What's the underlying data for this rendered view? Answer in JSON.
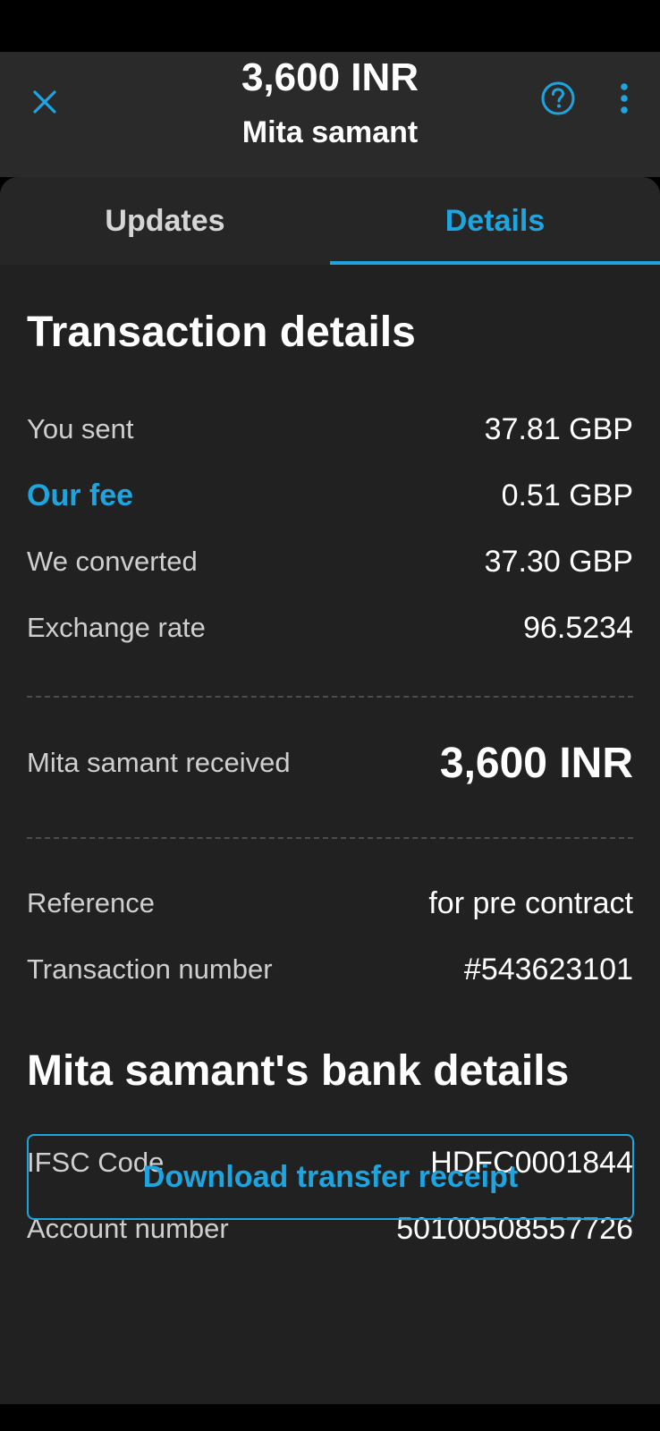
{
  "header": {
    "amount": "3,600 INR",
    "recipient": "Mita samant"
  },
  "icons": {
    "close": "close-icon",
    "help": "help-circle-icon",
    "more": "more-vertical-icon"
  },
  "tabs": [
    {
      "label": "Updates",
      "active": false
    },
    {
      "label": "Details",
      "active": true
    }
  ],
  "transaction": {
    "title": "Transaction details",
    "you_sent": {
      "label": "You sent",
      "value": "37.81 GBP"
    },
    "fee": {
      "label": "Our fee",
      "value": "0.51 GBP"
    },
    "converted": {
      "label": "We converted",
      "value": "37.30 GBP"
    },
    "rate": {
      "label": "Exchange rate",
      "value": "96.5234"
    },
    "received": {
      "label": "Mita samant received",
      "value": "3,600 INR"
    },
    "reference": {
      "label": "Reference",
      "value": "for pre contract"
    },
    "number": {
      "label": "Transaction number",
      "value": "#543623101"
    }
  },
  "bank": {
    "title": "Mita samant's bank details",
    "ifsc": {
      "label": "IFSC Code",
      "value": "HDFC0001844"
    },
    "account": {
      "label": "Account number",
      "value": "50100508557726"
    }
  },
  "actions": {
    "download_receipt": "Download transfer receipt"
  },
  "colors": {
    "accent": "#1ea5e0",
    "background": "#212121",
    "header_bg": "#2a2a2a",
    "text": "#ffffff",
    "muted_text": "#cfcfcf"
  }
}
